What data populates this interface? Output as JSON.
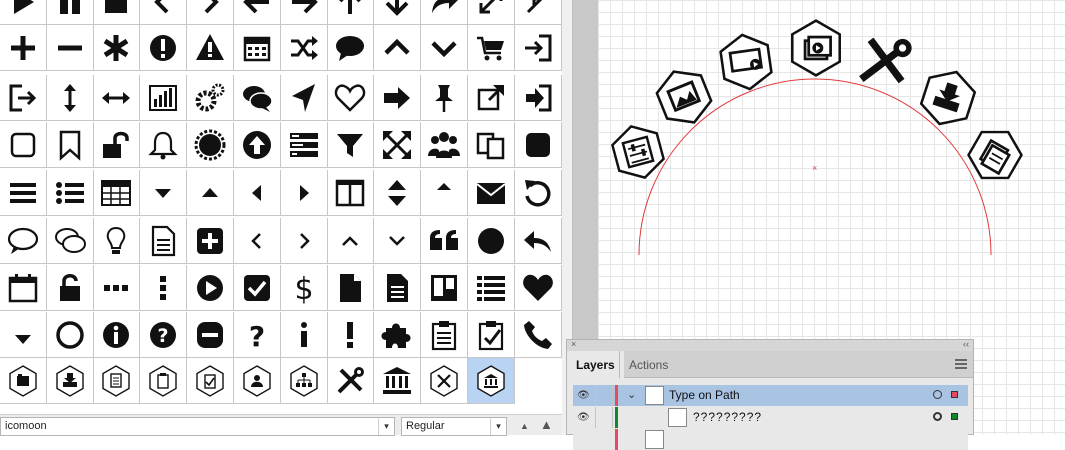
{
  "glyph_panel": {
    "font_family": "icomoon",
    "font_style": "Regular",
    "selected_glyph": "bank-hex",
    "rows": [
      [
        "play",
        "pause",
        "stop",
        "chevron-left",
        "chevron-right",
        "arrow-left",
        "arrow-right",
        "arrow-up",
        "arrow-down",
        "share",
        "expand",
        "compress"
      ],
      [
        "plus",
        "minus",
        "asterisk",
        "exclamation-circle",
        "warning",
        "calendar",
        "shuffle",
        "comment",
        "chevron-up",
        "chevron-down",
        "cart",
        "sign-in"
      ],
      [
        "sign-out",
        "arrows-v",
        "arrows-h",
        "bar-chart",
        "cogs",
        "comments",
        "location-arrow",
        "heart-outline",
        "hand-right",
        "thumbtack",
        "external-link",
        "arrow-right-square"
      ],
      [
        "square-outline",
        "bookmark",
        "unlock",
        "bell",
        "certificate",
        "arrow-circle-up",
        "tasks",
        "filter",
        "arrows-alt",
        "users",
        "files",
        "square"
      ],
      [
        "bars",
        "list",
        "table",
        "caret-down",
        "caret-up",
        "caret-left",
        "caret-right",
        "columns",
        "sort",
        "caret-up-small",
        "envelope",
        "undo"
      ],
      [
        "comment-outline",
        "comments-outline",
        "lightbulb",
        "file-text",
        "plus-square",
        "angle-left",
        "angle-right",
        "angle-up",
        "angle-down",
        "quote-left",
        "circle",
        "reply"
      ],
      [
        "calendar-outline",
        "unlock-alt",
        "ellipsis-h",
        "ellipsis-v",
        "play-circle",
        "check-square",
        "dollar",
        "file",
        "file-text-alt",
        "trello",
        "list-alt",
        "heart"
      ],
      [
        "sort-down",
        "circle-thin",
        "info-circle",
        "question-circle",
        "minus-circle",
        "question",
        "info",
        "exclamation",
        "puzzle",
        "clipboard",
        "clipboard-check",
        "phone"
      ],
      [
        "book-hex",
        "download-hex",
        "doc-hex",
        "clip-hex",
        "clip-check-hex",
        "user-hex",
        "org-hex",
        "tools",
        "bank",
        "tools-hex",
        "bank-hex"
      ]
    ]
  },
  "canvas": {
    "path_color": "#e23b3b",
    "icons_on_path": [
      "sliders-hex",
      "image-hex",
      "video-hex",
      "layers-video-hex",
      "tools",
      "download-hex",
      "docs-hex"
    ]
  },
  "layers_panel": {
    "tabs": [
      {
        "label": "Layers",
        "active": true
      },
      {
        "label": "Actions",
        "active": false
      }
    ],
    "rows": [
      {
        "label": "Type on Path",
        "selected": true,
        "color": "#e84a5f"
      },
      {
        "label": "?????????",
        "selected": false,
        "color": "#0a8a2a"
      },
      {
        "label": "",
        "selected": false,
        "color": "#e84a5f"
      }
    ],
    "collapse_label": "‹‹",
    "close_label": "×"
  }
}
